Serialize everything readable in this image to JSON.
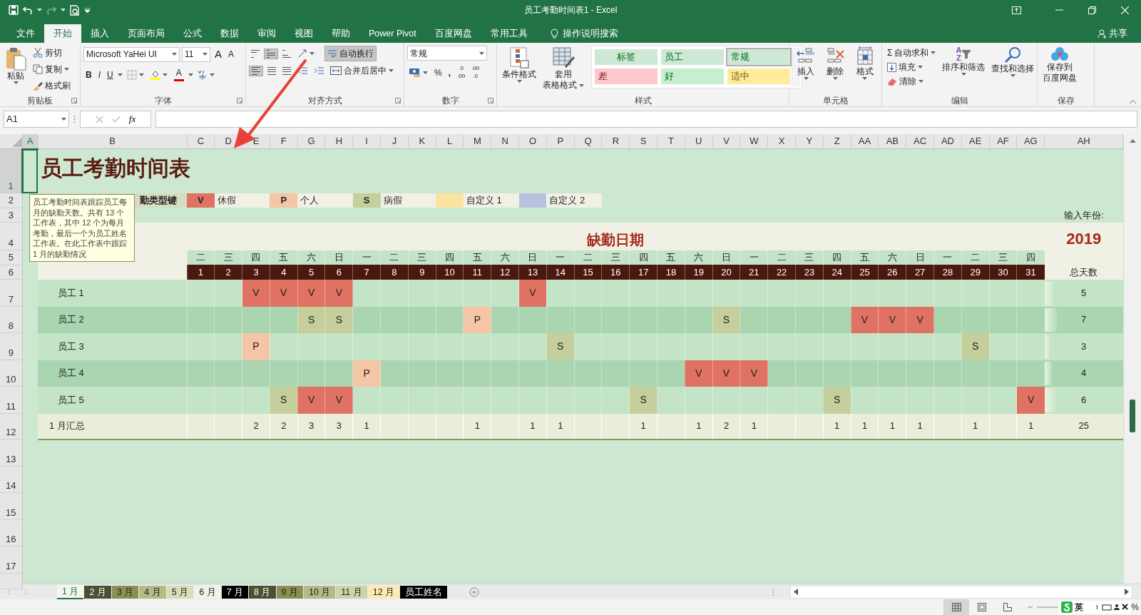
{
  "window": {
    "title": "员工考勤时间表1  -  Excel",
    "share": "共享"
  },
  "menu_tabs": [
    {
      "label": "文件",
      "selected": false
    },
    {
      "label": "开始",
      "selected": true
    },
    {
      "label": "插入",
      "selected": false
    },
    {
      "label": "页面布局",
      "selected": false
    },
    {
      "label": "公式",
      "selected": false
    },
    {
      "label": "数据",
      "selected": false
    },
    {
      "label": "审阅",
      "selected": false
    },
    {
      "label": "视图",
      "selected": false
    },
    {
      "label": "帮助",
      "selected": false
    },
    {
      "label": "Power Pivot",
      "selected": false
    },
    {
      "label": "百度网盘",
      "selected": false
    },
    {
      "label": "常用工具",
      "selected": false
    }
  ],
  "tell_me": "操作说明搜索",
  "ribbon": {
    "clipboard": {
      "label": "剪贴板",
      "paste": "粘贴",
      "cut": "剪切",
      "copy": "复制",
      "format_painter": "格式刷"
    },
    "font": {
      "label": "字体",
      "font_name": "Microsoft YaHei UI",
      "font_size": "11",
      "grow": "A",
      "shrink": "A",
      "bold": "B",
      "italic": "I",
      "underline": "U",
      "font_color": "A"
    },
    "alignment": {
      "label": "对齐方式",
      "vertical_pressed": [
        false,
        true,
        false
      ],
      "horizontal_pressed": [
        true,
        false,
        false
      ],
      "wrap_text": {
        "label": "自动换行",
        "pressed": true
      },
      "merge": "合并后居中"
    },
    "number": {
      "label": "数字",
      "format": "常规",
      "percent": "%",
      "comma": ",",
      "decimals": [
        [
          ".0",
          ".00"
        ],
        [
          ".00",
          ".0"
        ]
      ]
    },
    "styles": {
      "label": "样式",
      "conditional": "条件格式",
      "table_format": [
        "套用",
        "表格格式"
      ],
      "gallery": [
        {
          "label": "标签",
          "color": "#cfe8d5",
          "selected": false
        },
        {
          "label": "员工",
          "color": "#cfe8d5",
          "selected": false
        },
        {
          "label": "常规",
          "color": "#cfe8d5",
          "selected": true
        },
        {
          "label": "差",
          "color": "#ffc7ce",
          "selected": false
        },
        {
          "label": "好",
          "color": "#c6efce",
          "selected": false
        },
        {
          "label": "适中",
          "color": "#ffeb9c",
          "selected": false
        }
      ]
    },
    "cells": {
      "label": "单元格",
      "buttons": [
        {
          "kind": "insert",
          "label": "插入"
        },
        {
          "kind": "delete",
          "label": "删除"
        },
        {
          "kind": "format",
          "label": "格式"
        }
      ]
    },
    "editing": {
      "label": "编辑",
      "sigma": "Σ",
      "autosum": "自动求和",
      "fill": "填充",
      "clear": "清除",
      "sort_letters": [
        "A",
        "Z"
      ],
      "sort": "排序和筛选",
      "find": "查找和选择"
    },
    "save": {
      "label": "保存",
      "button": [
        "保存到",
        "百度网盘"
      ]
    }
  },
  "formula_bar": {
    "name_box": "A1",
    "fx": "fx"
  },
  "columns": [
    "A",
    "B",
    "C",
    "D",
    "E",
    "F",
    "G",
    "H",
    "I",
    "J",
    "K",
    "L",
    "M",
    "N",
    "O",
    "P",
    "Q",
    "R",
    "S",
    "T",
    "U",
    "V",
    "W",
    "X",
    "Y",
    "Z",
    "AA",
    "AB",
    "AC",
    "AD",
    "AE",
    "AF",
    "AG",
    "AH"
  ],
  "rows": [
    "1",
    "2",
    "3",
    "4",
    "5",
    "6",
    "7",
    "8",
    "9",
    "10",
    "11",
    "12",
    "13",
    "14",
    "15",
    "16",
    "17"
  ],
  "sheet": {
    "title": "员工考勤时间表",
    "legend_label": "勤类型键",
    "legend": [
      {
        "kind": "vacation",
        "code": "V",
        "label": "休假",
        "color": "#df7262"
      },
      {
        "kind": "personal",
        "code": "P",
        "label": "个人",
        "color": "#f5c6a6"
      },
      {
        "kind": "sick",
        "code": "S",
        "label": "病假",
        "color": "#c4cf9b"
      },
      {
        "kind": "custom1",
        "label": "自定义 1",
        "color": "#fde3a0"
      },
      {
        "kind": "custom2",
        "label": "自定义 2",
        "color": "#b9c1e0"
      }
    ],
    "year_label": "输入年份:",
    "year": "2019",
    "heading": "缺勤日期",
    "total_heading": "总天数",
    "weekdays": [
      "二",
      "三",
      "四",
      "五",
      "六",
      "日",
      "一",
      "二",
      "三",
      "四",
      "五",
      "六",
      "日",
      "一",
      "二",
      "三",
      "四",
      "五",
      "六",
      "日",
      "一",
      "二",
      "三",
      "四",
      "五",
      "六",
      "日",
      "一",
      "二",
      "三",
      "四"
    ],
    "days": [
      "1",
      "2",
      "3",
      "4",
      "5",
      "6",
      "7",
      "8",
      "9",
      "10",
      "11",
      "12",
      "13",
      "14",
      "15",
      "16",
      "17",
      "18",
      "19",
      "20",
      "21",
      "22",
      "23",
      "24",
      "25",
      "26",
      "27",
      "28",
      "29",
      "30",
      "31"
    ],
    "employees": [
      {
        "name": "员工 1",
        "total": "5",
        "level": 0.11,
        "marks": [
          {
            "kind": "none"
          },
          {
            "kind": "none"
          },
          {
            "kind": "vacation",
            "code": "V"
          },
          {
            "kind": "vacation",
            "code": "V"
          },
          {
            "kind": "vacation",
            "code": "V"
          },
          {
            "kind": "vacation",
            "code": "V"
          },
          {
            "kind": "none"
          },
          {
            "kind": "none"
          },
          {
            "kind": "none"
          },
          {
            "kind": "none"
          },
          {
            "kind": "none"
          },
          {
            "kind": "none"
          },
          {
            "kind": "vacation",
            "code": "V"
          },
          {
            "kind": "none"
          },
          {
            "kind": "none"
          },
          {
            "kind": "none"
          },
          {
            "kind": "none"
          },
          {
            "kind": "none"
          },
          {
            "kind": "none"
          },
          {
            "kind": "none"
          },
          {
            "kind": "none"
          },
          {
            "kind": "none"
          },
          {
            "kind": "none"
          },
          {
            "kind": "none"
          },
          {
            "kind": "none"
          },
          {
            "kind": "none"
          },
          {
            "kind": "none"
          },
          {
            "kind": "none"
          },
          {
            "kind": "none"
          },
          {
            "kind": "none"
          },
          {
            "kind": "none"
          }
        ]
      },
      {
        "name": "员工 2",
        "total": "7",
        "level": 0.16,
        "marks": [
          {
            "kind": "none"
          },
          {
            "kind": "none"
          },
          {
            "kind": "none"
          },
          {
            "kind": "none"
          },
          {
            "kind": "sick",
            "code": "S"
          },
          {
            "kind": "sick",
            "code": "S"
          },
          {
            "kind": "none"
          },
          {
            "kind": "none"
          },
          {
            "kind": "none"
          },
          {
            "kind": "none"
          },
          {
            "kind": "personal",
            "code": "P"
          },
          {
            "kind": "none"
          },
          {
            "kind": "none"
          },
          {
            "kind": "none"
          },
          {
            "kind": "none"
          },
          {
            "kind": "none"
          },
          {
            "kind": "none"
          },
          {
            "kind": "none"
          },
          {
            "kind": "none"
          },
          {
            "kind": "sick",
            "code": "S"
          },
          {
            "kind": "none"
          },
          {
            "kind": "none"
          },
          {
            "kind": "none"
          },
          {
            "kind": "none"
          },
          {
            "kind": "vacation",
            "code": "V"
          },
          {
            "kind": "vacation",
            "code": "V"
          },
          {
            "kind": "vacation",
            "code": "V"
          },
          {
            "kind": "none"
          },
          {
            "kind": "none"
          },
          {
            "kind": "none"
          },
          {
            "kind": "none"
          }
        ]
      },
      {
        "name": "员工 3",
        "total": "3",
        "level": 0.07,
        "marks": [
          {
            "kind": "none"
          },
          {
            "kind": "none"
          },
          {
            "kind": "personal",
            "code": "P"
          },
          {
            "kind": "none"
          },
          {
            "kind": "none"
          },
          {
            "kind": "none"
          },
          {
            "kind": "none"
          },
          {
            "kind": "none"
          },
          {
            "kind": "none"
          },
          {
            "kind": "none"
          },
          {
            "kind": "none"
          },
          {
            "kind": "none"
          },
          {
            "kind": "none"
          },
          {
            "kind": "sick",
            "code": "S"
          },
          {
            "kind": "none"
          },
          {
            "kind": "none"
          },
          {
            "kind": "none"
          },
          {
            "kind": "none"
          },
          {
            "kind": "none"
          },
          {
            "kind": "none"
          },
          {
            "kind": "none"
          },
          {
            "kind": "none"
          },
          {
            "kind": "none"
          },
          {
            "kind": "none"
          },
          {
            "kind": "none"
          },
          {
            "kind": "none"
          },
          {
            "kind": "none"
          },
          {
            "kind": "none"
          },
          {
            "kind": "sick",
            "code": "S"
          },
          {
            "kind": "none"
          },
          {
            "kind": "none"
          }
        ]
      },
      {
        "name": "员工 4",
        "total": "4",
        "level": 0.09,
        "marks": [
          {
            "kind": "none"
          },
          {
            "kind": "none"
          },
          {
            "kind": "none"
          },
          {
            "kind": "none"
          },
          {
            "kind": "none"
          },
          {
            "kind": "none"
          },
          {
            "kind": "personal",
            "code": "P"
          },
          {
            "kind": "none"
          },
          {
            "kind": "none"
          },
          {
            "kind": "none"
          },
          {
            "kind": "none"
          },
          {
            "kind": "none"
          },
          {
            "kind": "none"
          },
          {
            "kind": "none"
          },
          {
            "kind": "none"
          },
          {
            "kind": "none"
          },
          {
            "kind": "none"
          },
          {
            "kind": "none"
          },
          {
            "kind": "vacation",
            "code": "V"
          },
          {
            "kind": "vacation",
            "code": "V"
          },
          {
            "kind": "vacation",
            "code": "V"
          },
          {
            "kind": "none"
          },
          {
            "kind": "none"
          },
          {
            "kind": "none"
          },
          {
            "kind": "none"
          },
          {
            "kind": "none"
          },
          {
            "kind": "none"
          },
          {
            "kind": "none"
          },
          {
            "kind": "none"
          },
          {
            "kind": "none"
          },
          {
            "kind": "none"
          }
        ]
      },
      {
        "name": "员工 5",
        "total": "6",
        "level": 0.14,
        "marks": [
          {
            "kind": "none"
          },
          {
            "kind": "none"
          },
          {
            "kind": "none"
          },
          {
            "kind": "sick",
            "code": "S"
          },
          {
            "kind": "vacation",
            "code": "V"
          },
          {
            "kind": "vacation",
            "code": "V"
          },
          {
            "kind": "none"
          },
          {
            "kind": "none"
          },
          {
            "kind": "none"
          },
          {
            "kind": "none"
          },
          {
            "kind": "none"
          },
          {
            "kind": "none"
          },
          {
            "kind": "none"
          },
          {
            "kind": "none"
          },
          {
            "kind": "none"
          },
          {
            "kind": "none"
          },
          {
            "kind": "sick",
            "code": "S"
          },
          {
            "kind": "none"
          },
          {
            "kind": "none"
          },
          {
            "kind": "none"
          },
          {
            "kind": "none"
          },
          {
            "kind": "none"
          },
          {
            "kind": "none"
          },
          {
            "kind": "sick",
            "code": "S"
          },
          {
            "kind": "none"
          },
          {
            "kind": "none"
          },
          {
            "kind": "none"
          },
          {
            "kind": "none"
          },
          {
            "kind": "none"
          },
          {
            "kind": "none"
          },
          {
            "kind": "vacation",
            "code": "V"
          }
        ]
      }
    ],
    "summary": {
      "label": "1 月汇总",
      "total": "25",
      "values": [
        {
          "kind": "blank"
        },
        {
          "kind": "blank"
        },
        {
          "kind": "count",
          "count": "2"
        },
        {
          "kind": "count",
          "count": "2"
        },
        {
          "kind": "count",
          "count": "3"
        },
        {
          "kind": "count",
          "count": "3"
        },
        {
          "kind": "count",
          "count": "1"
        },
        {
          "kind": "blank"
        },
        {
          "kind": "blank"
        },
        {
          "kind": "blank"
        },
        {
          "kind": "count",
          "count": "1"
        },
        {
          "kind": "blank"
        },
        {
          "kind": "count",
          "count": "1"
        },
        {
          "kind": "count",
          "count": "1"
        },
        {
          "kind": "blank"
        },
        {
          "kind": "blank"
        },
        {
          "kind": "count",
          "count": "1"
        },
        {
          "kind": "blank"
        },
        {
          "kind": "count",
          "count": "1"
        },
        {
          "kind": "count",
          "count": "2"
        },
        {
          "kind": "count",
          "count": "1"
        },
        {
          "kind": "blank"
        },
        {
          "kind": "blank"
        },
        {
          "kind": "count",
          "count": "1"
        },
        {
          "kind": "count",
          "count": "1"
        },
        {
          "kind": "count",
          "count": "1"
        },
        {
          "kind": "count",
          "count": "1"
        },
        {
          "kind": "blank"
        },
        {
          "kind": "count",
          "count": "1"
        },
        {
          "kind": "blank"
        },
        {
          "kind": "count",
          "count": "1"
        }
      ]
    },
    "comment": "员工考勤时间表跟踪员工每月的缺勤天数。共有 13 个工作表，其中 12 个为每月考勤，最后一个为员工姓名工作表。在此工作表中跟踪 1 月的缺勤情况"
  },
  "sheet_tabs": [
    {
      "label": "1 月",
      "color": "#f4f6ee",
      "selected": true
    },
    {
      "label": "2 月",
      "color": "#4a5030",
      "selected": false
    },
    {
      "label": "3 月",
      "color": "#8b9052",
      "selected": false
    },
    {
      "label": "4 月",
      "color": "#b5bb86",
      "selected": false
    },
    {
      "label": "5 月",
      "color": "#d9ddb8",
      "selected": false
    },
    {
      "label": "6 月",
      "color": "#f2f3e8",
      "selected": false
    },
    {
      "label": "7 月",
      "color": "#000000",
      "selected": false
    },
    {
      "label": "8 月",
      "color": "#4a5030",
      "selected": false
    },
    {
      "label": "9 月",
      "color": "#8b9052",
      "selected": false
    },
    {
      "label": "10 月",
      "color": "#b5bb86",
      "selected": false
    },
    {
      "label": "11 月",
      "color": "#cdd3a8",
      "selected": false
    },
    {
      "label": "12 月",
      "color": "#fde9b2",
      "selected": false
    },
    {
      "label": "员工姓名",
      "color": "#000000",
      "selected": false
    }
  ],
  "status_bar": {
    "ime": "英",
    "zoom_text": "%"
  }
}
